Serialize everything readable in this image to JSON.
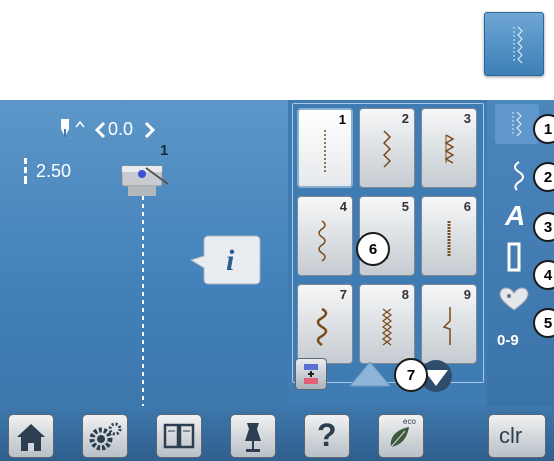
{
  "top_button": {
    "icon": "straight-stitch-pattern-icon"
  },
  "left_panel": {
    "needle_position_value": "0.0",
    "stitch_length_value": "2.50",
    "presser_foot_number": "1",
    "info_icon_label": "i"
  },
  "stitch_grid": {
    "cells": [
      {
        "number": "1",
        "pattern": "straight-stitch",
        "selected": true
      },
      {
        "number": "2",
        "pattern": "zigzag"
      },
      {
        "number": "3",
        "pattern": "vari-overlock"
      },
      {
        "number": "4",
        "pattern": "running-stitch"
      },
      {
        "number": "5",
        "pattern": "securing-stitch"
      },
      {
        "number": "6",
        "pattern": "triple-straight-stitch"
      },
      {
        "number": "7",
        "pattern": "triple-zigzag"
      },
      {
        "number": "8",
        "pattern": "honeycomb-stitch"
      },
      {
        "number": "9",
        "pattern": "blind-stitch"
      }
    ]
  },
  "right_menu": {
    "digits_label": "0-9",
    "alphabet_label": "A"
  },
  "callouts": [
    "1",
    "2",
    "3",
    "4",
    "5",
    "6",
    "7"
  ],
  "bottom_bar": {
    "clr_label": "clr",
    "help_label": "?",
    "eco_label": "eco"
  },
  "colors": {
    "screen_blue": "#3f7cb3",
    "accent_pink": "#e0607a",
    "button_grey": "#d4d8dc"
  }
}
